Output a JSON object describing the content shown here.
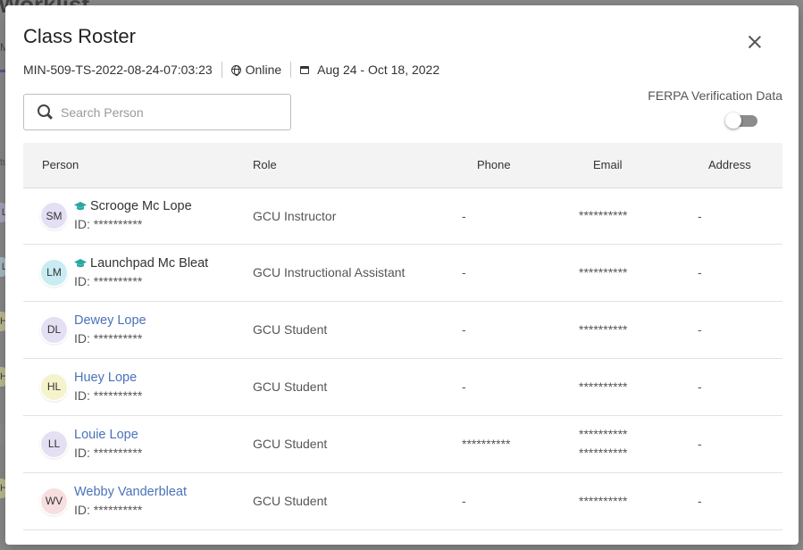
{
  "background": {
    "title": "Worklist",
    "tab": "M",
    "col_hint": "tu",
    "chips": [
      {
        "text": "L",
        "color": "#b8b2d8"
      },
      {
        "text": "L",
        "color": "#b7d6dd"
      },
      {
        "text": "H",
        "color": "#d8d49a"
      },
      {
        "text": "H",
        "color": "#d8d49a"
      },
      {
        "text": "",
        "color": "#8f8f8f"
      },
      {
        "text": "H",
        "color": "#d8d49a"
      }
    ]
  },
  "modal": {
    "title": "Class Roster",
    "course_code": "MIN-509-TS-2022-08-24-07:03:23",
    "modality": "Online",
    "date_range": "Aug 24 - Oct 18, 2022",
    "search_placeholder": "Search Person",
    "search_value": "",
    "ferpa_label": "FERPA Verification Data",
    "ferpa_enabled": false
  },
  "table": {
    "headers": {
      "person": "Person",
      "role": "Role",
      "phone": "Phone",
      "email": "Email",
      "address": "Address"
    },
    "rows": [
      {
        "initials": "SM",
        "avatar_color": "#e4dff3",
        "name": "Scrooge Mc Lope",
        "is_link": false,
        "is_instructor": true,
        "id": "ID: **********",
        "role": "GCU Instructor",
        "phone": "-",
        "email": [
          "**********"
        ],
        "address": "-"
      },
      {
        "initials": "LM",
        "avatar_color": "#c9ecf3",
        "name": "Launchpad Mc Bleat",
        "is_link": false,
        "is_instructor": true,
        "id": "ID: **********",
        "role": "GCU Instructional Assistant",
        "phone": "-",
        "email": [
          "**********"
        ],
        "address": "-"
      },
      {
        "initials": "DL",
        "avatar_color": "#e4dff3",
        "name": "Dewey Lope",
        "is_link": true,
        "is_instructor": false,
        "id": "ID: **********",
        "role": "GCU Student",
        "phone": "-",
        "email": [
          "**********"
        ],
        "address": "-"
      },
      {
        "initials": "HL",
        "avatar_color": "#f4f3cc",
        "name": "Huey Lope",
        "is_link": true,
        "is_instructor": false,
        "id": "ID: **********",
        "role": "GCU Student",
        "phone": "-",
        "email": [
          "**********"
        ],
        "address": "-"
      },
      {
        "initials": "LL",
        "avatar_color": "#e4dff3",
        "name": "Louie Lope",
        "is_link": true,
        "is_instructor": false,
        "id": "ID: **********",
        "role": "GCU Student",
        "phone": "**********",
        "email": [
          "**********",
          "**********"
        ],
        "address": "-"
      },
      {
        "initials": "WV",
        "avatar_color": "#f8dede",
        "name": "Webby Vanderbleat",
        "is_link": true,
        "is_instructor": false,
        "id": "ID: **********",
        "role": "GCU Student",
        "phone": "-",
        "email": [
          "**********"
        ],
        "address": "-"
      }
    ]
  },
  "icons": {
    "close": "close-icon",
    "modality": "globe-icon",
    "dates": "calendar-icon",
    "search": "search-icon",
    "instructor": "mortarboard-icon"
  },
  "colors": {
    "link": "#4a72b8",
    "instructor_badge": "#2aa7a0",
    "header_bg": "#f3f3f3"
  }
}
